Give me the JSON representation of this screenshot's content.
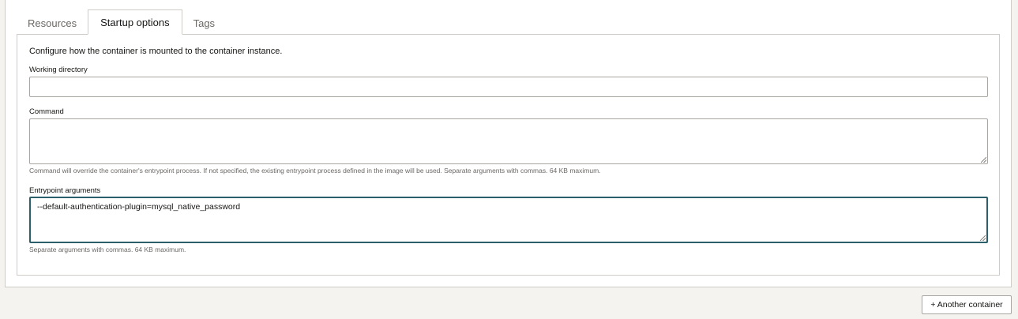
{
  "tabs": [
    {
      "label": "Resources",
      "active": false
    },
    {
      "label": "Startup options",
      "active": true
    },
    {
      "label": "Tags",
      "active": false
    }
  ],
  "startup": {
    "intro": "Configure how the container is mounted to the container instance.",
    "working_directory": {
      "label": "Working directory",
      "value": ""
    },
    "command": {
      "label": "Command",
      "value": "",
      "help": "Command will override the container's entrypoint process. If not specified, the existing entrypoint process defined in the image will be used. Separate arguments with commas. 64 KB maximum."
    },
    "entrypoint_arguments": {
      "label": "Entrypoint arguments",
      "value": "--default-authentication-plugin=mysql_native_password",
      "help": "Separate arguments with commas. 64 KB maximum."
    }
  },
  "actions": {
    "add_container": "+ Another container"
  },
  "colors": {
    "page_background": "#f4f3f0",
    "panel_background": "#ffffff",
    "border": "#cfccc7",
    "focus_border": "#2b5f6c",
    "muted_text": "#6b6866"
  }
}
